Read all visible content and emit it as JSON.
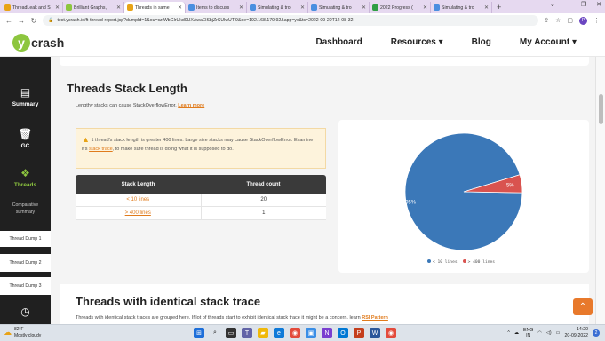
{
  "browser": {
    "tabs": [
      {
        "title": "ThreadLeak and S",
        "color": "#e8a317"
      },
      {
        "title": "Brilliant Graphs,",
        "color": "#8dc63f"
      },
      {
        "title": "Threads in same",
        "color": "#e8a317",
        "active": true
      },
      {
        "title": "Items to discuss",
        "color": "#4a8fe0"
      },
      {
        "title": "Simulating & tro",
        "color": "#4a8fe0"
      },
      {
        "title": "Simulating & tro",
        "color": "#4a8fe0"
      },
      {
        "title": "2022 Progress (",
        "color": "#2f9e44"
      },
      {
        "title": "Simulating & tro",
        "color": "#4a8fe0"
      }
    ],
    "new_tab": "+",
    "url": "test.ycrash.io/ft-thread-report.jsp?dumpId=1&ou=czlWbGlrUkd0UXAwaElSbjZrSUlwUTl9&de=192.168.179.92&app=yc&ts=2022-09-20T12-08-32"
  },
  "site": {
    "logo_letter": "y",
    "logo_text": "crash",
    "nav": {
      "dashboard": "Dashboard",
      "resources": "Resources ▾",
      "blog": "Blog",
      "account": "My Account ▾"
    }
  },
  "sidebar": {
    "summary": "Summary",
    "gc": "GC",
    "threads": "Threads",
    "comparative": "Comparative summary",
    "dump1": "Thread Dump 1",
    "dump2": "Thread Dump 2",
    "dump3": "Thread Dump 3"
  },
  "section": {
    "title": "Threads Stack Length",
    "subtitle": "Lengthy stacks can cause StackOverflowError.",
    "learn_more": "Learn more",
    "warning": {
      "prefix": "1 thread's stack length is greater 400 lines. Large size stacks may cause StackOverflowError. Examine it's",
      "link": "stack trace",
      "suffix": ", to make sure thread is doing what it is supposed to do."
    },
    "table": {
      "headers": [
        "Stack Length",
        "Thread count"
      ],
      "rows": [
        {
          "length": "< 10 lines",
          "count": "20"
        },
        {
          "length": "> 400 lines",
          "count": "1"
        }
      ]
    }
  },
  "chart_data": {
    "type": "pie",
    "categories": [
      "< 10 lines",
      "> 400 lines"
    ],
    "values": [
      95,
      5
    ],
    "labels": [
      "95%",
      "5%"
    ],
    "colors": [
      "#3b78b8",
      "#d9534f"
    ],
    "legend_position": "bottom"
  },
  "section2": {
    "title": "Threads with identical stack trace",
    "subtitle": "Threads with identical stack traces are grouped here. If lot of threads start to exhibit identical stack trace it might be a concern. learn",
    "link": "RSI Pattern"
  },
  "taskbar": {
    "temp": "82°F",
    "weather": "Mostly cloudy",
    "lang": "ENG",
    "region": "IN",
    "time": "14:20",
    "date": "20-09-2022",
    "notifications": "2"
  }
}
